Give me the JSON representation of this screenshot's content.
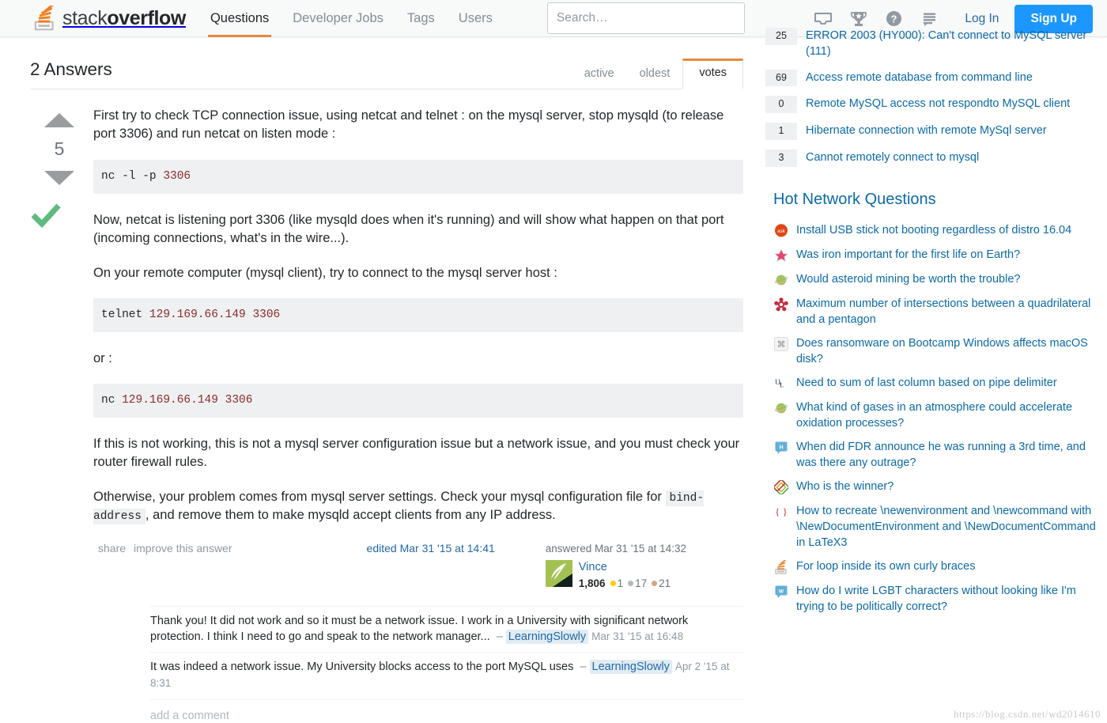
{
  "nav": {
    "logo_text_light": "stack",
    "logo_text_bold": "overflow",
    "items": [
      {
        "label": "Questions",
        "active": true
      },
      {
        "label": "Developer Jobs",
        "active": false
      },
      {
        "label": "Tags",
        "active": false
      },
      {
        "label": "Users",
        "active": false
      }
    ],
    "search_placeholder": "Search…",
    "search_value": "",
    "icons": [
      "inbox-icon",
      "trophy-icon",
      "help-icon",
      "chat-icon"
    ],
    "login_label": "Log In",
    "signup_label": "Sign Up",
    "accent_orange": "#e8883a",
    "link_blue": "#2369a8",
    "signup_blue": "#1c97ff"
  },
  "answers": {
    "title": "2 Answers",
    "tabs": [
      {
        "label": "active",
        "active": false
      },
      {
        "label": "oldest",
        "active": false
      },
      {
        "label": "votes",
        "active": true
      }
    ]
  },
  "answer": {
    "vote_score": "5",
    "accepted": true,
    "accepted_color": "#5eba7d",
    "paragraphs": {
      "p1": "First try to check TCP connection issue, using netcat and telnet : on the mysql server, stop mysqld (to release port 3306) and run netcat on listen mode :",
      "p2": "Now, netcat is listening port 3306 (like mysqld does when it's running) and will show what happen on that port (incoming connections, what's in the wire...).",
      "p3": "On your remote computer (mysql client), try to connect to the mysql server host :",
      "p4": "or :",
      "p5": "If this is not working, this is not a mysql server configuration issue but a network issue, and you must check your router firewall rules.",
      "p6_before": "Otherwise, your problem comes from mysql server settings. Check your mysql configuration file for ",
      "p6_code": "bind-address",
      "p6_after": ", and remove them to make mysqld accept clients from any IP address."
    },
    "code1": {
      "cmd": "nc -l -p ",
      "num": "3306"
    },
    "code2": {
      "cmd": "telnet ",
      "num": "129.169.66.149 3306"
    },
    "code3": {
      "cmd": "nc ",
      "num": "129.169.66.149 3306"
    },
    "footer": {
      "share": "share",
      "improve": "improve this answer",
      "edited": "edited Mar 31 '15 at 14:41",
      "answered": "answered Mar 31 '15 at 14:32",
      "username": "Vince",
      "reputation": "1,806",
      "gold": "1",
      "silver": "17",
      "bronze": "21"
    },
    "comments": [
      {
        "text": "Thank you! It did not work and so it must be a network issue. I work in a University with significant network protection. I think I need to go and speak to the network manager...",
        "user": "LearningSlowly",
        "time": "Mar 31 '15 at 16:48"
      },
      {
        "text": "It was indeed a network issue. My University blocks access to the port MySQL uses",
        "user": "LearningSlowly",
        "time": "Apr 2 '15 at 8:31"
      }
    ],
    "add_comment": "add a comment"
  },
  "sidebar": {
    "related": [
      {
        "score": "25",
        "title": "ERROR 2003 (HY000): Can't connect to MySQL server (111)",
        "clipped": true
      },
      {
        "score": "69",
        "title": "Access remote database from command line",
        "clipped": false
      },
      {
        "score": "0",
        "title": "Remote MySQL access not respondto MySQL client",
        "clipped": false
      },
      {
        "score": "1",
        "title": "Hibernate connection with remote MySql server",
        "clipped": false
      },
      {
        "score": "3",
        "title": "Cannot remotely connect to mysql",
        "clipped": false
      }
    ],
    "hot_title": "Hot Network Questions",
    "hot": [
      {
        "icon": "askubuntu-icon",
        "title": "Install USB stick not booting regardless of distro 16.04"
      },
      {
        "icon": "biology-icon",
        "title": "Was iron important for the first life on Earth?"
      },
      {
        "icon": "astronomy-icon",
        "title": "Would asteroid mining be worth the trouble?"
      },
      {
        "icon": "mathematics-icon",
        "title": "Maximum number of intersections between a quadrilateral and a pentagon"
      },
      {
        "icon": "apple-icon",
        "title": "Does ransomware on Bootcamp Windows affects macOS disk?"
      },
      {
        "icon": "unix-linux-icon",
        "title": "Need to sum of last column based on pipe delimiter"
      },
      {
        "icon": "astronomy-icon",
        "title": "What kind of gases in an atmosphere could accelerate oxidation processes?"
      },
      {
        "icon": "history-icon",
        "title": "When did FDR announce he was running a 3rd time, and was there any outrage?"
      },
      {
        "icon": "puzzling-icon",
        "title": "Who is the winner?"
      },
      {
        "icon": "tex-icon",
        "title": "How to recreate \\newenvironment and \\newcommand with \\NewDocumentEnvironment and \\NewDocumentCommand in LaTeX3"
      },
      {
        "icon": "stackoverflow-icon",
        "title": "For loop inside its own curly braces"
      },
      {
        "icon": "writers-icon",
        "title": "How do I write LGBT characters without looking like I'm trying to be politically correct?"
      }
    ],
    "watermark": "https://blog.csdn.net/wd2014610"
  }
}
